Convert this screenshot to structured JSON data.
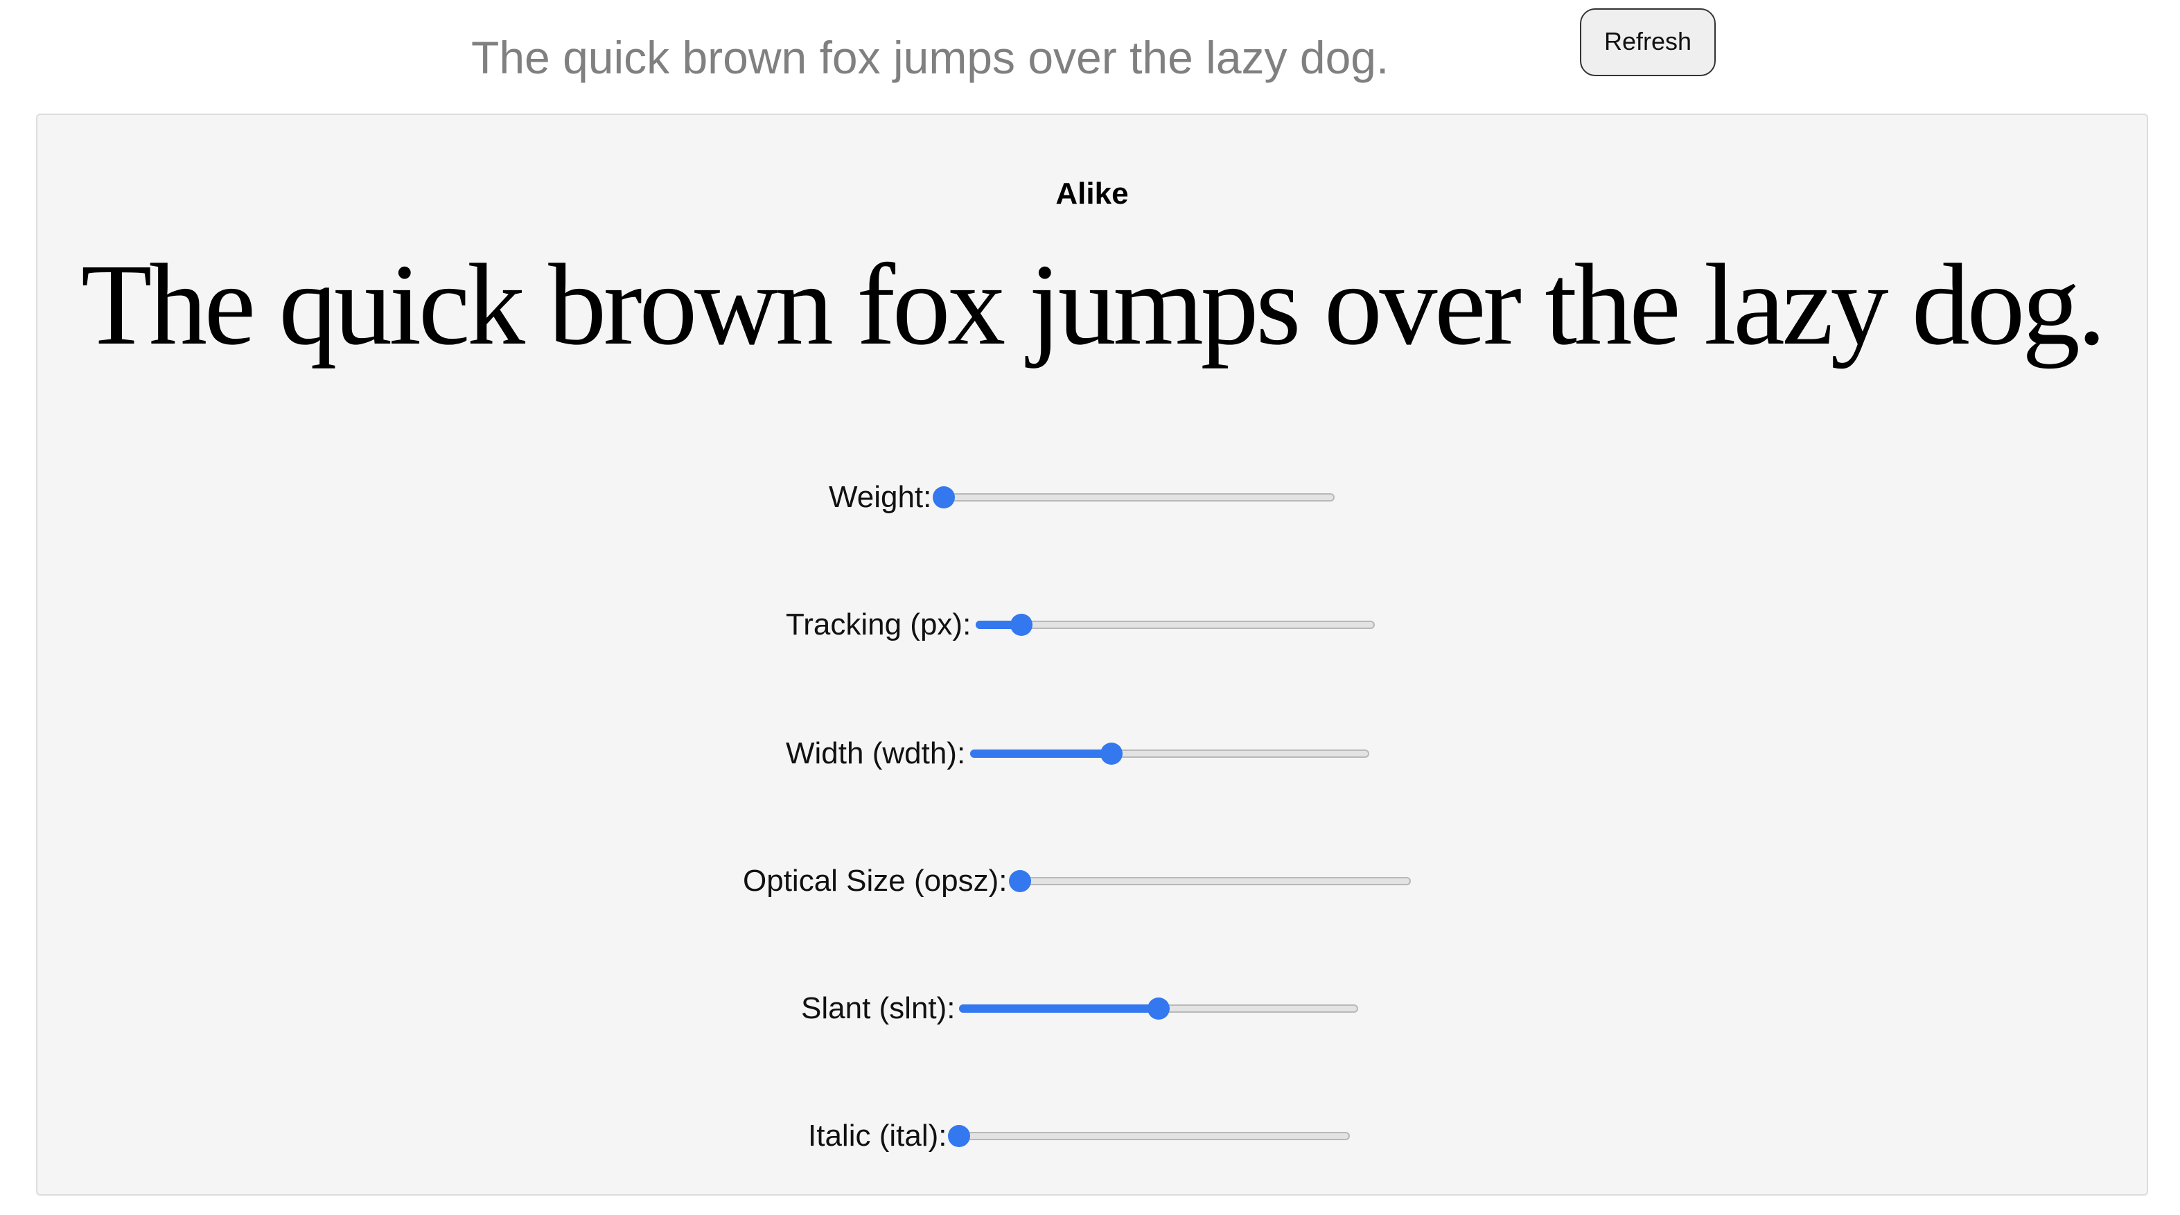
{
  "toolbar": {
    "sample_text": "The quick brown fox jumps over the lazy dog.",
    "refresh_label": "Refresh"
  },
  "panel": {
    "font_name": "Alike",
    "preview_text": "The quick brown fox jumps over the lazy dog."
  },
  "colors": {
    "accent": "#3478f0",
    "panel_background": "#f5f5f5",
    "placeholder_text": "#808080"
  },
  "controls": [
    {
      "id": "weight",
      "label": "Weight:",
      "value_fraction": 0.0
    },
    {
      "id": "tracking",
      "label": "Tracking (px):",
      "value_fraction": 0.1
    },
    {
      "id": "width",
      "label": "Width (wdth):",
      "value_fraction": 0.35
    },
    {
      "id": "opsz",
      "label": "Optical Size (opsz):",
      "value_fraction": 0.0
    },
    {
      "id": "slant",
      "label": "Slant (slnt):",
      "value_fraction": 0.5
    },
    {
      "id": "ital",
      "label": "Italic (ital):",
      "value_fraction": 0.0
    }
  ]
}
